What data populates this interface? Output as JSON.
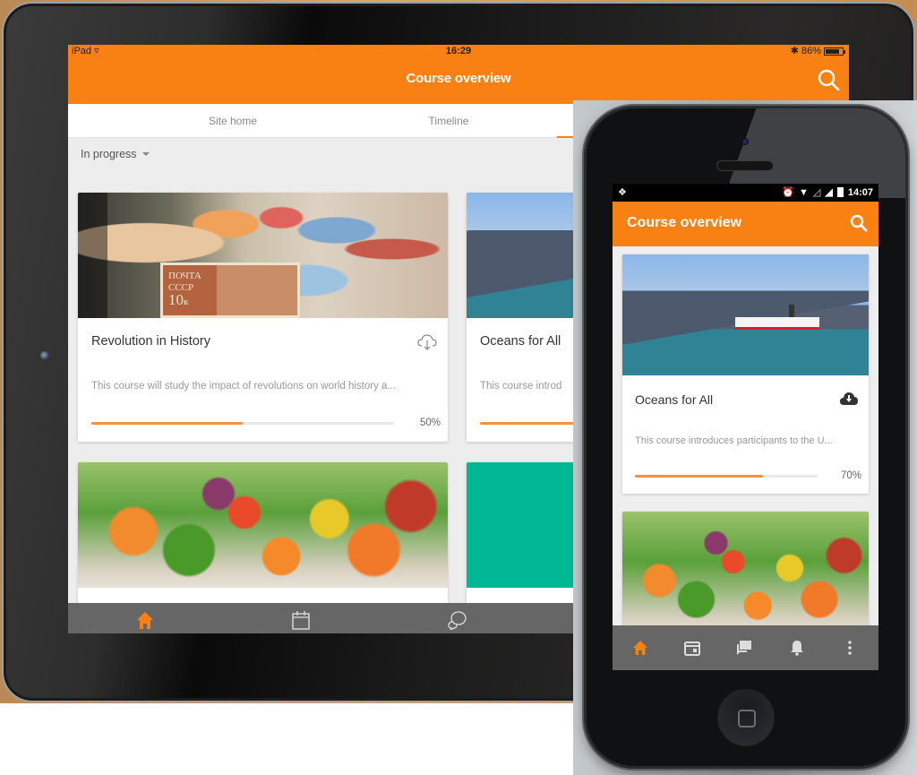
{
  "tablet": {
    "status_bar": {
      "device": "iPad",
      "time": "16:29",
      "battery": "86%",
      "battery_level": 0.86
    },
    "app_bar": {
      "title": "Course overview",
      "search_icon": "search-icon"
    },
    "tabs": [
      {
        "label": "Site home",
        "active": false
      },
      {
        "label": "Timeline",
        "active": false
      },
      {
        "label": "",
        "active": true
      }
    ],
    "filter": {
      "selected": "In progress"
    },
    "courses": [
      {
        "title": "Revolution in History",
        "description": "This course will study the impact of revolutions on world history a...",
        "progress": 50,
        "progress_label": "50%",
        "action_icon": "cloud-download-outline-icon",
        "image": "stamps",
        "stamp_text": "ПОЧТА\nСССР\n10к"
      },
      {
        "title": "Oceans for All",
        "description": "This course introd",
        "progress": 70,
        "image": "ocean"
      },
      {
        "title": "",
        "image": "vegetables"
      },
      {
        "title": "",
        "image": "teal"
      }
    ],
    "bottom_nav": [
      {
        "icon": "home-icon",
        "active": true
      },
      {
        "icon": "calendar-icon",
        "active": false
      },
      {
        "icon": "messages-icon",
        "active": false
      }
    ]
  },
  "phone": {
    "status_bar": {
      "time": "14:07",
      "left_icon": "dropbox-icon",
      "icons": [
        "alarm-icon",
        "wifi-icon",
        "signal-empty-icon",
        "signal-icon",
        "battery-icon"
      ]
    },
    "app_bar": {
      "title": "Course overview",
      "search_icon": "search-icon"
    },
    "courses": [
      {
        "title": "Oceans for All",
        "description": "This course introduces participants to the U...",
        "progress": 70,
        "progress_label": "70%",
        "action_icon": "cloud-download-icon",
        "image": "ocean-steamboat"
      },
      {
        "title": "",
        "image": "vegetables"
      }
    ],
    "bottom_nav": [
      {
        "icon": "home-icon",
        "active": true
      },
      {
        "icon": "calendar-icon",
        "active": false
      },
      {
        "icon": "messages-icon",
        "active": false
      },
      {
        "icon": "notifications-icon",
        "active": false
      },
      {
        "icon": "more-icon",
        "active": false
      }
    ]
  },
  "colors": {
    "brand_orange": "#f98012",
    "progress_orange": "#f9913a",
    "nav_gray": "#666666",
    "teal": "#00b894"
  }
}
